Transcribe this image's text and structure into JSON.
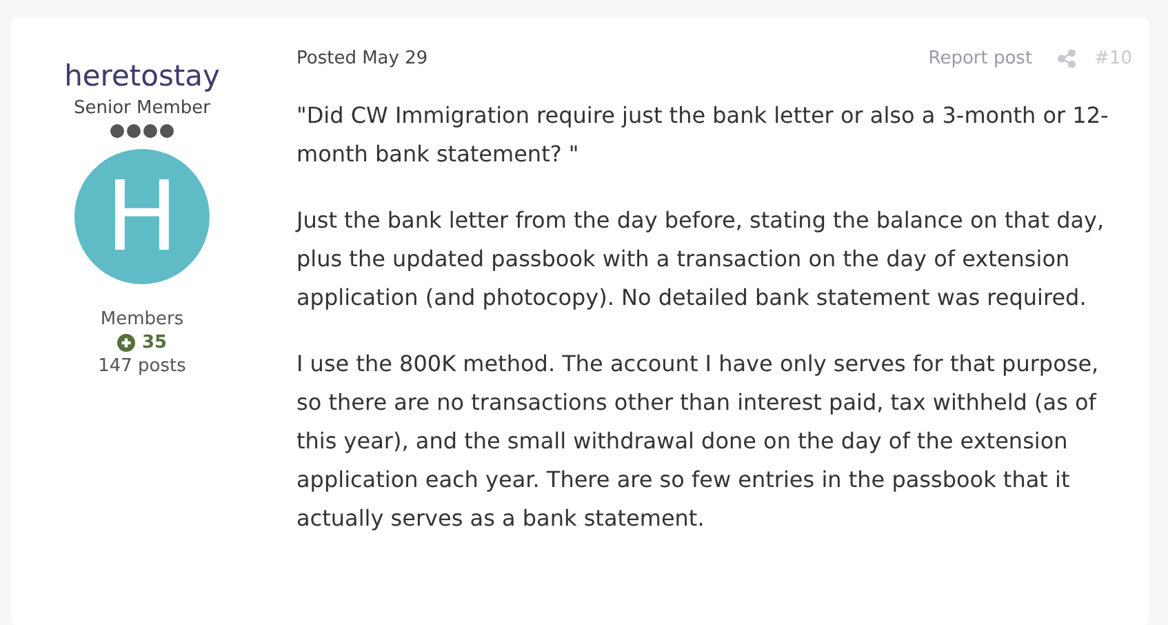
{
  "author": {
    "name": "heretostay",
    "title": "Senior Member",
    "stars": 4,
    "avatar_letter": "H",
    "group": "Members",
    "reputation": "35",
    "posts": "147 posts"
  },
  "post": {
    "date": "Posted May 29",
    "report": "Report post",
    "number": "#10",
    "paragraphs": [
      "\"Did CW Immigration require just the bank letter or also a 3-month or 12-month bank statement? \"",
      "Just the bank letter from the day before, stating the balance on that day, plus the updated passbook with a transaction on the day of extension application (and photocopy).  No detailed bank statement was required.",
      "I use the 800K method.  The account I have only serves for that purpose, so there are no transactions other than interest paid, tax withheld (as of this year), and the small withdrawal done on the day of the extension application each year.  There are so few entries in the passbook that it actually serves as a bank statement."
    ]
  }
}
